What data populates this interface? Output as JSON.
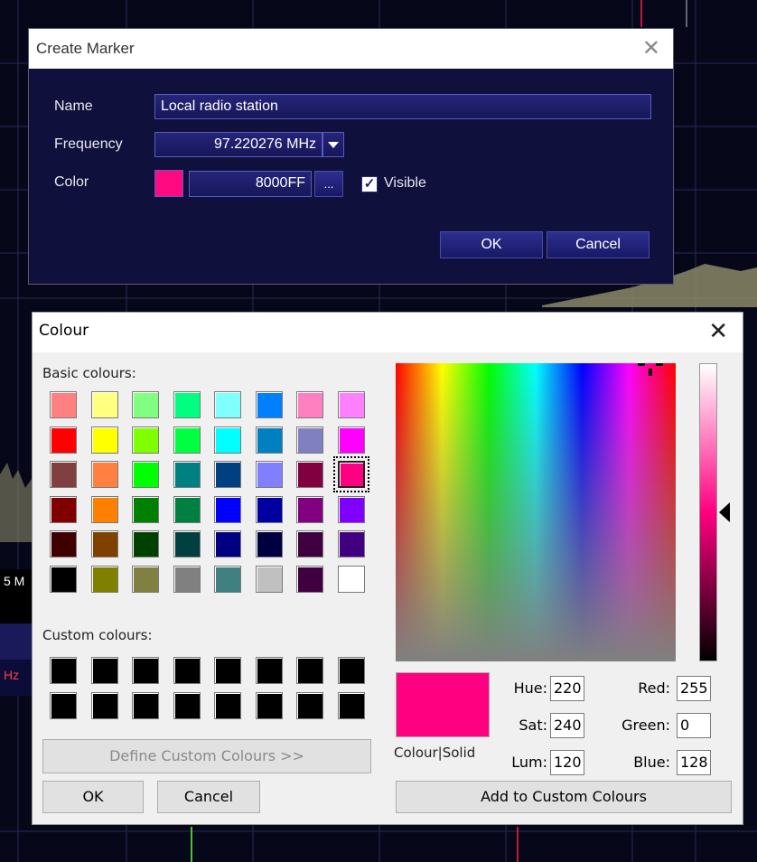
{
  "marker_dialog": {
    "title": "Create Marker",
    "name_label": "Name",
    "name_value": "Local radio station",
    "frequency_label": "Frequency",
    "frequency_value": "97.220276 MHz",
    "color_label": "Color",
    "color_value": "8000FF",
    "color_swatch": "#ff0a80",
    "browse_label": "...",
    "visible_label": "Visible",
    "visible_checked": true,
    "ok_label": "OK",
    "cancel_label": "Cancel"
  },
  "background": {
    "freq_fragment_1": "5 M",
    "freq_fragment_2": "Hz"
  },
  "colour_dialog": {
    "title": "Colour",
    "basic_label": "Basic colours:",
    "custom_label": "Custom colours:",
    "define_custom_label": "Define Custom Colours >>",
    "ok_label": "OK",
    "cancel_label": "Cancel",
    "preview_label": "Colour|Solid",
    "add_custom_label": "Add to Custom Colours",
    "hue_label": "Hue:",
    "hue_value": "220",
    "sat_label": "Sat:",
    "sat_value": "240",
    "lum_label": "Lum:",
    "lum_value": "120",
    "red_label": "Red:",
    "red_value": "255",
    "green_label": "Green:",
    "green_value": "0",
    "blue_label": "Blue:",
    "blue_value": "128",
    "selected_color": "#ff0080",
    "basic_colours": [
      "#ff8080",
      "#ffff80",
      "#80ff80",
      "#00ff80",
      "#80ffff",
      "#0080ff",
      "#ff80c0",
      "#ff80ff",
      "#ff0000",
      "#ffff00",
      "#80ff00",
      "#00ff40",
      "#00ffff",
      "#0080c0",
      "#8080c0",
      "#ff00ff",
      "#804040",
      "#ff8040",
      "#00ff00",
      "#008080",
      "#004080",
      "#8080ff",
      "#800040",
      "#ff0080",
      "#800000",
      "#ff8000",
      "#008000",
      "#008040",
      "#0000ff",
      "#0000a0",
      "#800080",
      "#8000ff",
      "#400000",
      "#804000",
      "#004000",
      "#004040",
      "#000080",
      "#000040",
      "#400040",
      "#400080",
      "#000000",
      "#808000",
      "#808040",
      "#808080",
      "#408080",
      "#c0c0c0",
      "#400040",
      "#ffffff"
    ],
    "custom_colours": [
      "#000000",
      "#000000",
      "#000000",
      "#000000",
      "#000000",
      "#000000",
      "#000000",
      "#000000",
      "#000000",
      "#000000",
      "#000000",
      "#000000",
      "#000000",
      "#000000",
      "#000000",
      "#000000"
    ]
  }
}
